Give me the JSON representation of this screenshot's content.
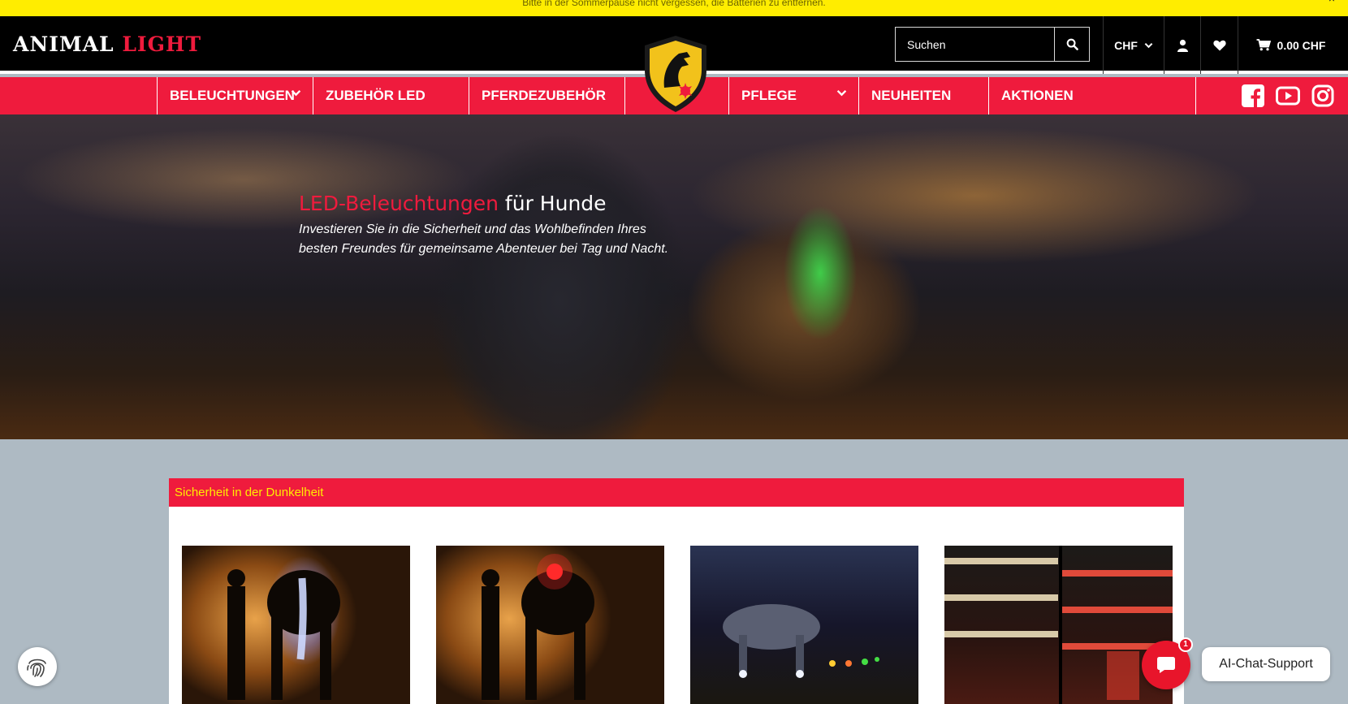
{
  "announcement": {
    "text": "Bitte in der Sommerpause nicht vergessen, die Batterien zu entfernen.",
    "close": "×"
  },
  "header": {
    "logo_part1": "ANIMAL",
    "logo_part2": "LIGHT",
    "search_placeholder": "Suchen",
    "currency": "CHF",
    "cart_total": "0.00 CHF"
  },
  "nav": {
    "items": [
      {
        "label": "BELEUCHTUNGEN",
        "has_dropdown": true
      },
      {
        "label": "ZUBEHÖR LED",
        "has_dropdown": false
      },
      {
        "label": "PFERDEZUBEHÖR",
        "has_dropdown": false
      },
      {
        "label": "",
        "has_dropdown": false
      },
      {
        "label": "PFLEGE",
        "has_dropdown": true
      },
      {
        "label": "NEUHEITEN",
        "has_dropdown": false
      },
      {
        "label": "AKTIONEN",
        "has_dropdown": false
      }
    ],
    "social": [
      "facebook-icon",
      "youtube-icon",
      "instagram-icon"
    ]
  },
  "hero": {
    "title_highlight": "LED-Beleuchtungen",
    "title_rest": " für Hunde",
    "subtitle_line1": "Investieren Sie in die Sicherheit und das Wohlbefinden Ihres",
    "subtitle_line2": "besten Freundes für gemeinsame Abenteuer bei Tag und Nacht."
  },
  "section": {
    "title": "Sicherheit in der Dunkelheit"
  },
  "chat": {
    "label": "AI-Chat-Support",
    "badge": "1"
  },
  "colors": {
    "brand_red": "#ef1b3d",
    "brand_yellow": "#ffed00",
    "header_black": "#000000",
    "page_bg": "#aebac3"
  }
}
